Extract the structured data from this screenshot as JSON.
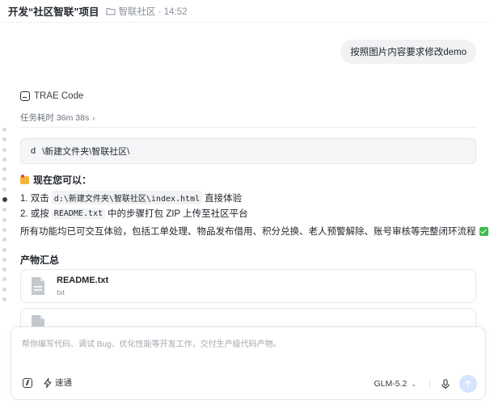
{
  "header": {
    "title": "开发“社区智联”项目",
    "folder": "智联社区 · 14:52"
  },
  "chat": {
    "user_message": "按照图片内容要求修改demo",
    "assistant_name": "TRAE Code",
    "task_time": "任务耗时 36m 38s",
    "code_drive": "d",
    "code_path": "\\新建文件夹\\智联社区\\",
    "now_heading": "现在您可以：",
    "step1_prefix": "1. 双击",
    "step1_code": "d:\\新建文件夹\\智联社区\\index.html",
    "step1_suffix": "直接体验",
    "step2_prefix": "2. 或按",
    "step2_code": "README.txt",
    "step2_suffix": "中的步骤打包 ZIP 上传至社区平台",
    "summary": "所有功能均已可交互体验，包括工单处理、物品发布借用、积分兑换、老人预警解除、账号审核等完整闭环流程",
    "artifacts_title": "产物汇总",
    "file_name": "README.txt",
    "file_ext": "txt"
  },
  "composer": {
    "placeholder": "帮你编写代码、调试 Bug、优化性能等开发工作，交付生产级代码产物。",
    "speed_label": "速通",
    "model": "GLM-5.2"
  },
  "icons": {
    "folder": "folder-icon",
    "chevron": "chevron-right-icon",
    "file": "file-icon",
    "lightning": "lightning-icon",
    "mic": "mic-icon",
    "send": "arrow-up-icon"
  },
  "colors": {
    "send_button": "#d6e4ff",
    "check": "#3fb950"
  }
}
